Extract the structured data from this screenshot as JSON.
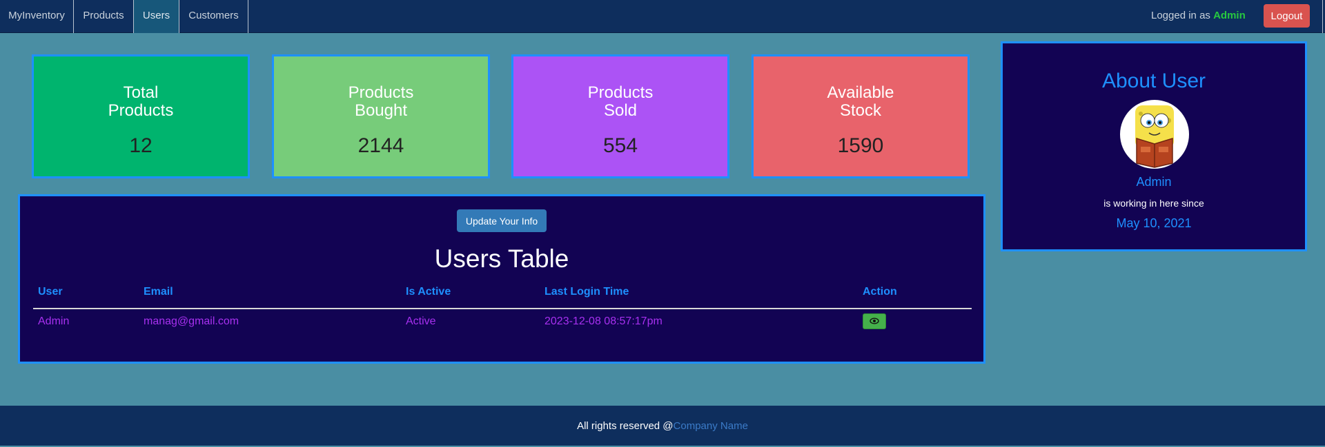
{
  "nav": {
    "brand": "MyInventory",
    "items": [
      "Products",
      "Users",
      "Customers"
    ],
    "active": "Users",
    "login_prefix": "Logged in as ",
    "login_user": "Admin",
    "logout_label": "Logout"
  },
  "cards": [
    {
      "title": "Total\nProducts",
      "value": "12",
      "color": "#00b46e"
    },
    {
      "title": "Products\nBought",
      "value": "2144",
      "color": "#77cc7a"
    },
    {
      "title": "Products\nSold",
      "value": "554",
      "color": "#ac53f5"
    },
    {
      "title": "Available\nStock",
      "value": "1590",
      "color": "#e8636b"
    }
  ],
  "users_table": {
    "update_button": "Update Your Info",
    "title": "Users Table",
    "columns": [
      "User",
      "Email",
      "Is Active",
      "Last Login Time",
      "Action"
    ],
    "rows": [
      {
        "user": "Admin",
        "email": "manag@gmail.com",
        "is_active": "Active",
        "last_login": "2023-12-08 08:57:17pm",
        "action_icon": "eye-icon"
      }
    ]
  },
  "about": {
    "title": "About User",
    "name": "Admin",
    "since_text": "is working in here since",
    "date": "May 10, 2021",
    "avatar_icon": "spongebob-reading-avatar"
  },
  "footer": {
    "text": "All rights reserved @",
    "link": "Company Name"
  },
  "colors": {
    "accent": "#1e90ff",
    "nav_bg": "#0e2e5d",
    "panel_bg": "#120353",
    "page_bg": "#4a8ea3",
    "logout": "#d9534f",
    "active_status": "#a830f0"
  }
}
